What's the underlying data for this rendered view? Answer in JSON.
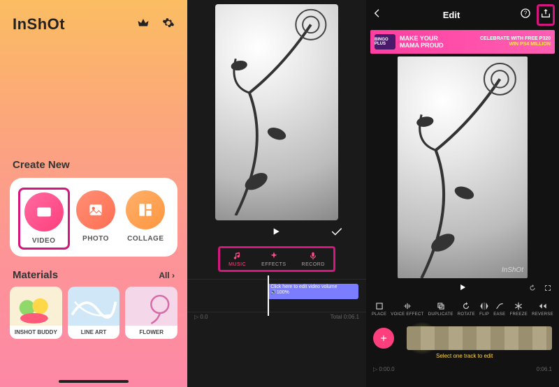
{
  "home": {
    "logo": "InShOt",
    "create_label": "Create New",
    "create": [
      {
        "id": "video",
        "label": "VIDEO"
      },
      {
        "id": "photo",
        "label": "PHOTO"
      },
      {
        "id": "collage",
        "label": "COLLAGE"
      }
    ],
    "materials_label": "Materials",
    "materials_all": "All ›",
    "materials": [
      {
        "id": "inshot-buddy",
        "label": "INSHOT BUDDY"
      },
      {
        "id": "line-art",
        "label": "LINE ART"
      },
      {
        "id": "flower",
        "label": "FLOWER"
      }
    ]
  },
  "music_picker": {
    "tabs": [
      {
        "id": "music",
        "label": "MUSIC"
      },
      {
        "id": "effects",
        "label": "EFFECTS"
      },
      {
        "id": "record",
        "label": "RECORD"
      }
    ],
    "volume_hint": "Click here to edit video volume",
    "volume_value": "🔊100%",
    "time_start": "▷ 0.0",
    "time_end": "Total 0:06.1"
  },
  "editor": {
    "title": "Edit",
    "ad": {
      "brand": "BINGO PLUS",
      "line1": "MAKE YOUR",
      "line2": "MAMA PROUD",
      "promo1": "CELEBRATE WITH FREE P320",
      "promo2": "WIN PS4 MILLION"
    },
    "watermark": "InShOt",
    "tools": [
      {
        "id": "place",
        "label": "PLACE"
      },
      {
        "id": "effect",
        "label": "VOICE EFFECT"
      },
      {
        "id": "duplicate",
        "label": "DUPLICATE"
      },
      {
        "id": "rotate",
        "label": "ROTATE"
      },
      {
        "id": "flip",
        "label": "FLIP"
      },
      {
        "id": "ease",
        "label": "EASE"
      },
      {
        "id": "freeze",
        "label": "FREEZE"
      },
      {
        "id": "reverse",
        "label": "REVERSE"
      }
    ],
    "select_hint": "Select one track to edit",
    "time_start": "▷ 0:00.0",
    "time_end": "0:06.1"
  },
  "highlights": {
    "video_button": true,
    "music_tabs": true,
    "share_button": true
  },
  "colors": {
    "highlight": "#d4177d",
    "accent": "#ff3f7d"
  }
}
